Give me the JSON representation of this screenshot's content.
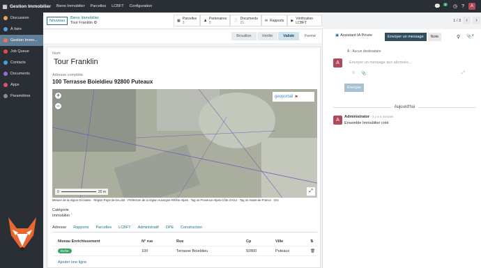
{
  "topbar": {
    "app_name": "Gestion Immobilier",
    "menus": [
      "Biens Immobilier",
      "Parcelles",
      "LCBFT",
      "Configuration"
    ],
    "chat_badge": "5",
    "user_initial": "A"
  },
  "sidebar": {
    "items": [
      {
        "label": "Discussion",
        "color": "#f0a65c"
      },
      {
        "label": "À faire",
        "color": "#5aa0d8"
      },
      {
        "label": "Gestion Immo...",
        "color": "#e9765a"
      },
      {
        "label": "Job Queue",
        "color": "#e34b4b"
      },
      {
        "label": "Contacts",
        "color": "#3fa4d8"
      },
      {
        "label": "Documents",
        "color": "#9a6bd1"
      },
      {
        "label": "Apps",
        "color": "#e1546e"
      },
      {
        "label": "Paramètres",
        "color": "#8c8c8c"
      }
    ]
  },
  "control": {
    "new_label": "Nouveau",
    "breadcrumb_parent": "Biens Immobilier",
    "breadcrumb_current": "Tour Franklin",
    "smart_buttons": [
      {
        "label": "Parcelles",
        "count": "3"
      },
      {
        "label": "Partenaires",
        "count": "3"
      },
      {
        "label": "Documents",
        "count": "21"
      },
      {
        "label": "Rapports",
        "count": ""
      },
      {
        "label": "Vérification LCBFT",
        "count": ""
      }
    ],
    "pager": "1 / 3"
  },
  "stages": [
    "Brouillon",
    "Vérifié",
    "Validé",
    "Fermé"
  ],
  "form": {
    "name_label": "Nom",
    "name": "Tour Franklin",
    "address_label": "Adresse complète",
    "address": "100 Terrasse Boieldieu 92800 Puteaux",
    "category_label": "Catégorie",
    "category_value": "Immobilier",
    "map": {
      "logo": "geoportail",
      "scale": "20 m",
      "attribution": "Mesure de la région Occitanie · Région Pays-de-la-Loire · Préfecture de la région Auvergne-Rhône-Alpes · Tag on Provence-Alpes-Côte d'Azur · Tag on Hauts-de-France · Occ"
    },
    "tabs": [
      "Adresse",
      "Rapports",
      "Parcelles",
      "LCBFT",
      "Administratif",
      "DPE",
      "Construction"
    ],
    "table": {
      "headers": [
        "Niveau Enrichissement",
        "N° rue",
        "Rue",
        "Cp",
        "Ville"
      ],
      "rows": [
        {
          "status": "Riche",
          "num": "100",
          "street": "Terrasse Boieldieu",
          "cp": "92800",
          "city": "Puteaux"
        }
      ],
      "add_line": "Ajouter une ligne"
    }
  },
  "chatter": {
    "assistant": "Assistant IA Privée",
    "send_message": "Envoyer un message",
    "note": "Note",
    "followers_count": "2",
    "recipient": "À : Aucun destinataire",
    "placeholder": "Envoyer un message aux abonnés...",
    "send": "Envoyer",
    "day": "Aujourd'hui",
    "author": "Administrator",
    "time": "- il y a 4 minutes",
    "message": "Ensemble Immobilier créé",
    "avatar_initial": "A"
  }
}
